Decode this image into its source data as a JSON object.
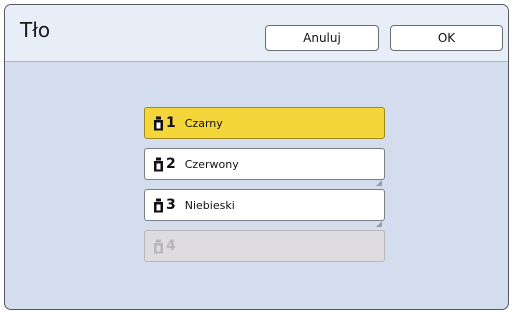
{
  "dialog": {
    "title": "Tło"
  },
  "header": {
    "cancel_label": "Anuluj",
    "ok_label": "OK"
  },
  "inks": [
    {
      "number": "1",
      "label": "Czarny",
      "selected": true,
      "enabled": true,
      "icon": "ink-bottle-icon"
    },
    {
      "number": "2",
      "label": "Czerwony",
      "selected": false,
      "enabled": true,
      "icon": "ink-bottle-icon"
    },
    {
      "number": "3",
      "label": "Niebieski",
      "selected": false,
      "enabled": true,
      "icon": "ink-bottle-icon"
    },
    {
      "number": "4",
      "label": "",
      "selected": false,
      "enabled": false,
      "icon": "ink-bottle-icon"
    }
  ],
  "colors": {
    "selected": "#f4d53a",
    "background": "#d4dded",
    "header": "#e8eef8",
    "disabled": "#dfdcdf"
  }
}
